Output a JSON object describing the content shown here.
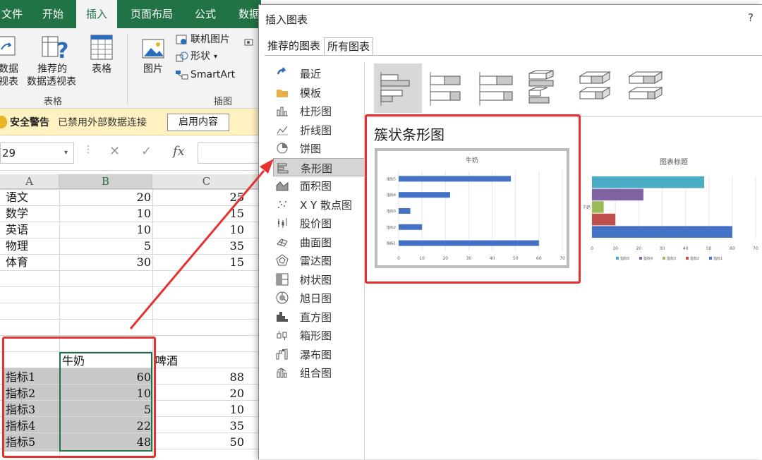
{
  "excel": {
    "tabs": [
      "文件",
      "开始",
      "插入",
      "页面布局",
      "公式",
      "数据"
    ],
    "active_tab": "插入",
    "ribbon": {
      "pivot_table_label_1": "数据",
      "pivot_table_label_2": "视表",
      "recommended_pivot_1": "推荐的",
      "recommended_pivot_2": "数据透视表",
      "table_label": "表格",
      "picture_label": "图片",
      "online_picture_label": "联机图片",
      "shapes_label": "形状",
      "smartart_label": "SmartArt",
      "group_tables": "表格",
      "group_illustrations": "插图"
    },
    "security_bar": {
      "title": "安全警告",
      "message": "已禁用外部数据连接",
      "button": "启用内容"
    },
    "formula_bar": {
      "name_box": "29",
      "cancel": "✕",
      "enter": "✓",
      "fx": "fx"
    },
    "columns": [
      "A",
      "B",
      "C"
    ],
    "table1": [
      {
        "name": "语文",
        "b": "20",
        "c": "25"
      },
      {
        "name": "数学",
        "b": "10",
        "c": "15"
      },
      {
        "name": "英语",
        "b": "10",
        "c": "10"
      },
      {
        "name": "物理",
        "b": "5",
        "c": "35"
      },
      {
        "name": "体育",
        "b": "30",
        "c": "15"
      }
    ],
    "table2": {
      "header_b": "牛奶",
      "header_c": "啤酒",
      "rows": [
        {
          "name": "指标1",
          "b": "60",
          "c": "88"
        },
        {
          "name": "指标2",
          "b": "10",
          "c": "20"
        },
        {
          "name": "指标3",
          "b": "5",
          "c": "10"
        },
        {
          "name": "指标4",
          "b": "22",
          "c": "35"
        },
        {
          "name": "指标5",
          "b": "48",
          "c": "50"
        }
      ]
    }
  },
  "dialog": {
    "title": "插入图表",
    "help": "?",
    "tabs": [
      "推荐的图表",
      "所有图表"
    ],
    "active_tab": "所有图表",
    "categories": [
      {
        "label": "最近",
        "icon": "recent-icon"
      },
      {
        "label": "模板",
        "icon": "folder-icon"
      },
      {
        "label": "柱形图",
        "icon": "column-chart-icon"
      },
      {
        "label": "折线图",
        "icon": "line-chart-icon"
      },
      {
        "label": "饼图",
        "icon": "pie-chart-icon"
      },
      {
        "label": "条形图",
        "icon": "bar-chart-icon"
      },
      {
        "label": "面积图",
        "icon": "area-chart-icon"
      },
      {
        "label": "X Y 散点图",
        "icon": "scatter-chart-icon"
      },
      {
        "label": "股价图",
        "icon": "stock-chart-icon"
      },
      {
        "label": "曲面图",
        "icon": "surface-chart-icon"
      },
      {
        "label": "雷达图",
        "icon": "radar-chart-icon"
      },
      {
        "label": "树状图",
        "icon": "treemap-chart-icon"
      },
      {
        "label": "旭日图",
        "icon": "sunburst-chart-icon"
      },
      {
        "label": "直方图",
        "icon": "histogram-chart-icon"
      },
      {
        "label": "箱形图",
        "icon": "box-whisker-chart-icon"
      },
      {
        "label": "瀑布图",
        "icon": "waterfall-chart-icon"
      },
      {
        "label": "组合图",
        "icon": "combo-chart-icon"
      }
    ],
    "selected_category": "条形图",
    "subtype_name": "簇状条形图",
    "highlight_color": "#e53131"
  },
  "chart_data": [
    {
      "type": "bar",
      "orientation": "horizontal",
      "title": "牛奶",
      "categories": [
        "指标1",
        "指标2",
        "指标3",
        "指标4",
        "指标5"
      ],
      "values": [
        60,
        10,
        5,
        22,
        48
      ],
      "xlim": [
        0,
        70
      ],
      "xticks": [
        "0",
        "10",
        "20",
        "30",
        "40",
        "50",
        "60",
        "70"
      ],
      "color": "#4472c4",
      "grid": true
    },
    {
      "type": "bar",
      "orientation": "horizontal",
      "title": "图表标题",
      "categories": [
        "牛奶"
      ],
      "series": [
        {
          "name": "指标1",
          "values": [
            60
          ],
          "color": "#4472c4"
        },
        {
          "name": "指标2",
          "values": [
            10
          ],
          "color": "#c0504d"
        },
        {
          "name": "指标3",
          "values": [
            5
          ],
          "color": "#9bbb59"
        },
        {
          "name": "指标4",
          "values": [
            22
          ],
          "color": "#8064a2"
        },
        {
          "name": "指标5",
          "values": [
            48
          ],
          "color": "#4bacc6"
        }
      ],
      "legend_order": [
        "指标5",
        "指标4",
        "指标3",
        "指标2",
        "指标1"
      ],
      "xlim": [
        0,
        70
      ],
      "xticks": [
        "0",
        "10",
        "20",
        "30",
        "40",
        "50",
        "60",
        "70"
      ],
      "legend": "bottom",
      "grid": true
    }
  ]
}
